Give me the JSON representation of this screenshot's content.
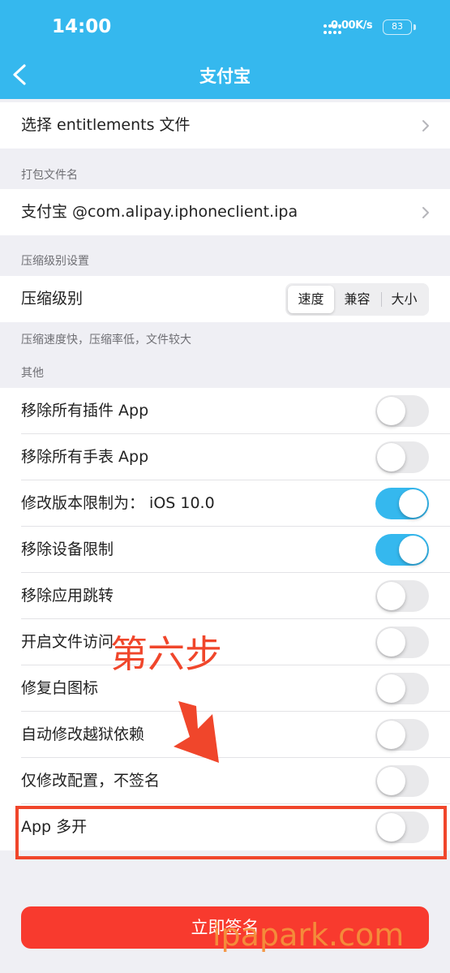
{
  "status_bar": {
    "time": "14:00",
    "net_speed": "0.00K/s",
    "battery": "83"
  },
  "nav": {
    "title": "支付宝"
  },
  "rows": {
    "entitlements": "选择 entitlements 文件",
    "package_name_section": "打包文件名",
    "package_name": "支付宝 @com.alipay.iphoneclient.ipa",
    "compression_section": "压缩级别设置",
    "compression_label": "压缩级别",
    "compression_options": [
      "速度",
      "兼容",
      "大小"
    ],
    "compression_selected": "速度",
    "compression_hint": "压缩速度快，压缩率低，文件较大",
    "other_section": "其他"
  },
  "toggles": [
    {
      "label": "移除所有插件 App",
      "on": false
    },
    {
      "label": "移除所有手表 App",
      "on": false
    },
    {
      "label": "修改版本限制为：  iOS 10.0",
      "on": true
    },
    {
      "label": "移除设备限制",
      "on": true
    },
    {
      "label": "移除应用跳转",
      "on": false
    },
    {
      "label": "开启文件访问",
      "on": false
    },
    {
      "label": "修复白图标",
      "on": false
    },
    {
      "label": "自动修改越狱依赖",
      "on": false
    },
    {
      "label": "仅修改配置，不签名",
      "on": false
    },
    {
      "label": "App 多开",
      "on": false
    }
  ],
  "annotation": {
    "text": "第六步"
  },
  "sign_button": "立即签名",
  "watermark": "ipapark.com",
  "colors": {
    "header": "#35b8ee",
    "toggle_on": "#35b8ee",
    "accent_red": "#f0462b",
    "button": "#f83a2e",
    "watermark": "#f4923c"
  }
}
